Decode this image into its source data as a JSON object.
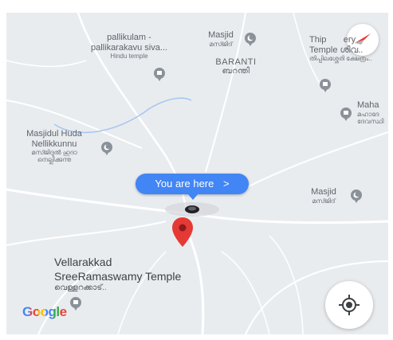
{
  "map": {
    "pois": [
      {
        "name": "pallikulam - pallikarakavu siva...",
        "line1": "pallikulam -",
        "line2": "pallikarakavu siva...",
        "category": "Hindu temple"
      },
      {
        "name": "Masjid",
        "malayalam": "മസ്ജിദ്"
      },
      {
        "name": "Thippilassery Temple",
        "line1": "Thip       ery",
        "line2": "Temple ശിവ..",
        "malayalam": "തിപ്പിലശ്ശേരി ക്ഷേത്രം.."
      },
      {
        "name": "Maha",
        "malayalam1": "മഹാദേ",
        "malayalam2": "ദേവസ്ഥി"
      },
      {
        "name": "Masjidul Huda Nellikkunnu",
        "line1": "Masjidul Huda",
        "line2": "Nellikkunnu",
        "malayalam1": "മസ്ജിദുൽ ഹുദാ",
        "malayalam2": "നെല്ലിക്കുന്നു"
      },
      {
        "name": "Masjid",
        "malayalam": "മസ്ജിദ്"
      }
    ],
    "area_label": {
      "name": "BARANTI",
      "malayalam": "ബറന്തി"
    },
    "place": {
      "line1": "Vellarakkad",
      "line2": "SreeRamaswamy Temple",
      "malayalam": "വെള്ളറക്കാട്.."
    },
    "you_are_here": "You are here",
    "bubble_arrow": ">",
    "logo": "Google",
    "logo_colors": [
      "#4285F4",
      "#EA4335",
      "#FBBC05",
      "#4285F4",
      "#34A853",
      "#EA4335"
    ],
    "colors": {
      "map_bg": "#e9ecef",
      "road": "#ffffff",
      "water": "#a8c7f0",
      "poi_pin": "#8a9199",
      "marker": "#e53935",
      "accent": "#4285f4"
    },
    "icons": [
      "compass-icon",
      "my-location-icon",
      "location-pin-icon",
      "mosque-icon",
      "temple-icon"
    ]
  }
}
